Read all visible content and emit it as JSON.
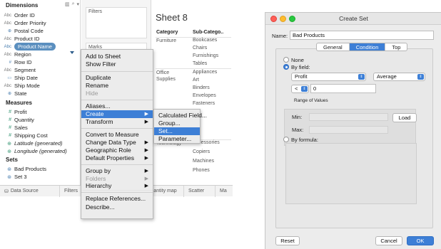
{
  "data_pane": {
    "dimensions_label": "Dimensions",
    "measures_label": "Measures",
    "sets_label": "Sets",
    "dimensions": [
      {
        "type": "Abc",
        "label": "Order ID"
      },
      {
        "type": "Abc",
        "label": "Order Priority"
      },
      {
        "type": "globe",
        "label": "Postal Code"
      },
      {
        "type": "Abc",
        "label": "Product ID"
      },
      {
        "type": "Abc",
        "label": "Product Name",
        "selected": true
      },
      {
        "type": "Abc",
        "label": "Region"
      },
      {
        "type": "#",
        "label": "Row ID"
      },
      {
        "type": "Abc",
        "label": "Segment"
      },
      {
        "type": "date",
        "label": "Ship Date"
      },
      {
        "type": "Abc",
        "label": "Ship Mode"
      },
      {
        "type": "globe",
        "label": "State"
      }
    ],
    "measures": [
      {
        "type": "#",
        "label": "Profit"
      },
      {
        "type": "#",
        "label": "Quantity"
      },
      {
        "type": "#",
        "label": "Sales"
      },
      {
        "type": "#",
        "label": "Shipping Cost"
      },
      {
        "type": "globe",
        "label": "Latitude (generated)",
        "italic": true
      },
      {
        "type": "globe",
        "label": "Longitude (generated)",
        "italic": true
      }
    ],
    "sets": [
      {
        "label": "Bad Products"
      },
      {
        "label": "Set 3"
      }
    ]
  },
  "shelves": {
    "filters_label": "Filters",
    "marks_label": "Marks"
  },
  "sheet": {
    "title": "Sheet 8",
    "col_category": "Category",
    "col_subcategory": "Sub-Catego..",
    "groups": [
      {
        "category": "Furniture",
        "subs": [
          "Bookcases",
          "Chairs",
          "Furnishings",
          "Tables"
        ]
      },
      {
        "category": "Office Supplies",
        "subs": [
          "Appliances",
          "Art",
          "Binders",
          "Envelopes",
          "Fasteners"
        ]
      },
      {
        "category": "Technology",
        "subs": [
          "Accessories",
          "Copiers",
          "Machines",
          "Phones"
        ]
      }
    ]
  },
  "bottom_tabs": [
    "Data Source",
    "Filters",
    "Quantity map",
    "Scatter",
    "Ma"
  ],
  "context_menu": {
    "items": [
      {
        "label": "Add to Sheet"
      },
      {
        "label": "Show Filter"
      },
      {
        "label": "Duplicate"
      },
      {
        "label": "Rename"
      },
      {
        "label": "Hide",
        "disabled": true
      },
      {
        "label": "Aliases..."
      },
      {
        "label": "Create",
        "submenu": true,
        "highlighted": true
      },
      {
        "label": "Transform",
        "submenu": true
      },
      {
        "label": "Convert to Measure"
      },
      {
        "label": "Change Data Type",
        "submenu": true
      },
      {
        "label": "Geographic Role",
        "submenu": true
      },
      {
        "label": "Default Properties",
        "submenu": true
      },
      {
        "label": "Group by",
        "submenu": true
      },
      {
        "label": "Folders",
        "submenu": true,
        "disabled": true
      },
      {
        "label": "Hierarchy",
        "submenu": true
      },
      {
        "label": "Replace References..."
      },
      {
        "label": "Describe..."
      }
    ]
  },
  "create_submenu": {
    "items": [
      {
        "label": "Calculated Field..."
      },
      {
        "label": "Group..."
      },
      {
        "label": "Set...",
        "highlighted": true
      },
      {
        "label": "Parameter..."
      }
    ]
  },
  "dialog": {
    "title": "Create Set",
    "name_label": "Name:",
    "name_value": "Bad Products",
    "tabs": [
      "General",
      "Condition",
      "Top"
    ],
    "active_tab": "Condition",
    "none_label": "None",
    "by_field_label": "By field:",
    "field_value": "Profit",
    "aggregation_value": "Average",
    "operator_value": "<",
    "threshold_value": "0",
    "range_label": "Range of Values",
    "min_label": "Min:",
    "max_label": "Max:",
    "load_label": "Load",
    "by_formula_label": "By formula:",
    "reset_label": "Reset",
    "cancel_label": "Cancel",
    "ok_label": "OK",
    "accent_color": "#3d7fd6"
  }
}
